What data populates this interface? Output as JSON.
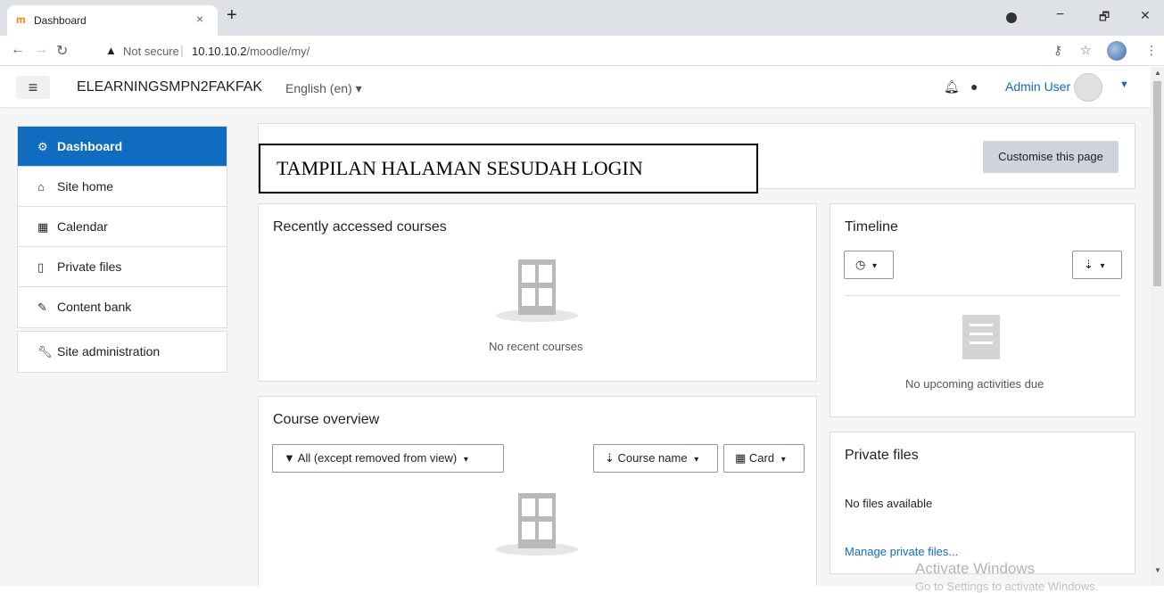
{
  "browser": {
    "tab_title": "Dashboard",
    "tab_close": "×",
    "new_tab": "+",
    "not_secure": "Not secure",
    "url_host": "10.10.10.2",
    "url_path": "/moodle/my/",
    "win_min": "−",
    "win_max": "🗗",
    "win_close": "✕"
  },
  "navbar": {
    "site_name": "ELEARNINGSMPN2FAKFAK",
    "language": "English (en) ▾",
    "user_name": "Admin User"
  },
  "sidebar": {
    "items": [
      {
        "label": "Dashboard",
        "icon": "dashboard-icon"
      },
      {
        "label": "Site home",
        "icon": "home-icon"
      },
      {
        "label": "Calendar",
        "icon": "calendar-icon"
      },
      {
        "label": "Private files",
        "icon": "file-icon"
      },
      {
        "label": "Content bank",
        "icon": "brush-icon"
      }
    ],
    "admin_item": {
      "label": "Site administration",
      "icon": "wrench-icon"
    }
  },
  "header": {
    "annotation": "TAMPILAN HALAMAN SESUDAH LOGIN",
    "customise_button": "Customise this page"
  },
  "recent_courses": {
    "title": "Recently accessed courses",
    "empty": "No recent courses"
  },
  "course_overview": {
    "title": "Course overview",
    "filter": "All (except removed from view)",
    "sort": "Course name",
    "view": "Card"
  },
  "timeline": {
    "title": "Timeline",
    "empty": "No upcoming activities due"
  },
  "private_files": {
    "title": "Private files",
    "empty": "No files available",
    "manage_link": "Manage private files..."
  },
  "watermark": {
    "line1": "Activate Windows",
    "line2": "Go to Settings to activate Windows."
  },
  "colors": {
    "primary": "#0f6cbf",
    "background": "#f5f5f5"
  }
}
